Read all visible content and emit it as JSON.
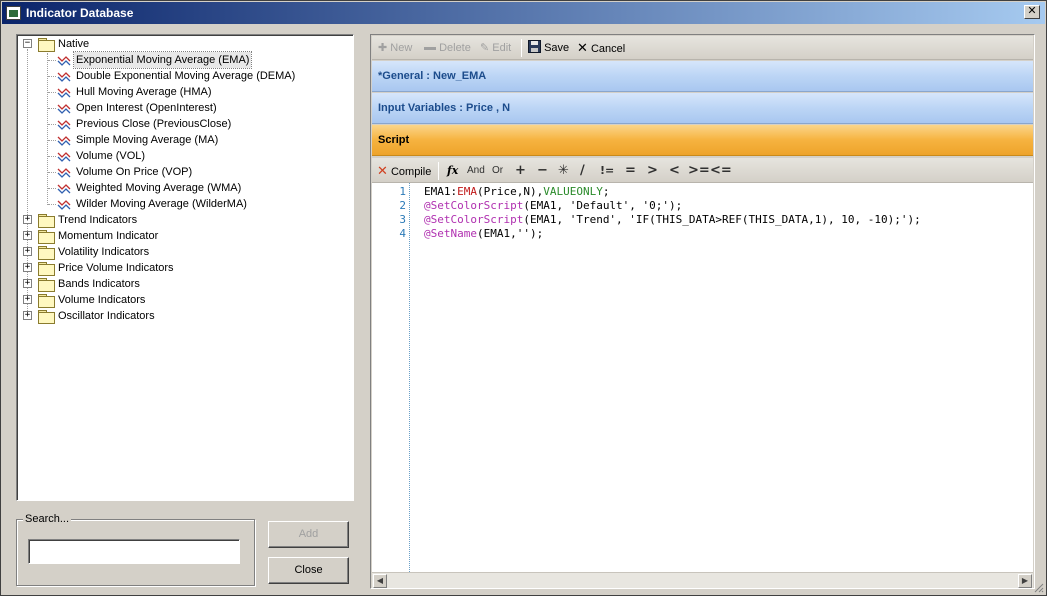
{
  "window": {
    "title": "Indicator Database",
    "close_glyph": "✕"
  },
  "tree": {
    "root": {
      "label": "Native",
      "expander": "−"
    },
    "native_items": [
      {
        "label": "Exponential Moving Average (EMA)",
        "selected": true
      },
      {
        "label": "Double Exponential Moving Average (DEMA)"
      },
      {
        "label": "Hull Moving Average (HMA)"
      },
      {
        "label": "Open Interest (OpenInterest)"
      },
      {
        "label": "Previous Close (PreviousClose)"
      },
      {
        "label": "Simple Moving Average (MA)"
      },
      {
        "label": "Volume (VOL)"
      },
      {
        "label": "Volume On Price (VOP)"
      },
      {
        "label": "Weighted Moving Average (WMA)"
      },
      {
        "label": "Wilder Moving Average (WilderMA)"
      }
    ],
    "groups": [
      {
        "label": "Trend Indicators",
        "expander": "+"
      },
      {
        "label": "Momentum Indicator",
        "expander": "+"
      },
      {
        "label": "Volatility Indicators",
        "expander": "+"
      },
      {
        "label": "Price Volume Indicators",
        "expander": "+"
      },
      {
        "label": "Bands Indicators",
        "expander": "+"
      },
      {
        "label": "Volume Indicators",
        "expander": "+"
      },
      {
        "label": "Oscillator Indicators",
        "expander": "+"
      }
    ]
  },
  "search": {
    "legend": "Search...",
    "value": "",
    "placeholder": ""
  },
  "buttons": {
    "add": "Add",
    "close": "Close"
  },
  "toolbar": {
    "new": "New",
    "delete": "Delete",
    "edit": "Edit",
    "save": "Save",
    "cancel": "Cancel"
  },
  "sections": {
    "general": "*General : New_EMA",
    "inputs": "Input Variables : Price , N",
    "script": "Script"
  },
  "script_toolbar": {
    "compile": "Compile",
    "fx": "fx",
    "and": "And",
    "or": "Or",
    "ops": [
      "+",
      "−",
      "✳",
      "∕",
      "!=",
      "=",
      ">",
      "<",
      ">=",
      "<="
    ]
  },
  "code": {
    "line_numbers": [
      "1",
      "2",
      "3",
      "4"
    ],
    "lines": [
      [
        {
          "t": "EMA1",
          "c": "plain"
        },
        {
          "t": ":",
          "c": "plain"
        },
        {
          "t": "EMA",
          "c": "func"
        },
        {
          "t": "(Price,N),",
          "c": "plain"
        },
        {
          "t": "VALUEONLY",
          "c": "kw"
        },
        {
          "t": ";",
          "c": "plain"
        }
      ],
      [
        {
          "t": "@SetColorScript",
          "c": "at"
        },
        {
          "t": "(EMA1, 'Default', '0;');",
          "c": "plain"
        }
      ],
      [
        {
          "t": "@SetColorScript",
          "c": "at"
        },
        {
          "t": "(EMA1, 'Trend', 'IF(THIS_DATA>REF(THIS_DATA,1), 10, -10);');",
          "c": "plain"
        }
      ],
      [
        {
          "t": "@SetName",
          "c": "at"
        },
        {
          "t": "(EMA1,'');",
          "c": "plain"
        }
      ]
    ]
  },
  "colors": {
    "section_blue_text": "#1c4c8c",
    "section_orange": "#f6b340",
    "code_func": "#c01818",
    "code_keyword": "#2a8a2a",
    "code_directive": "#b030b0",
    "line_number": "#2b7ab8"
  }
}
